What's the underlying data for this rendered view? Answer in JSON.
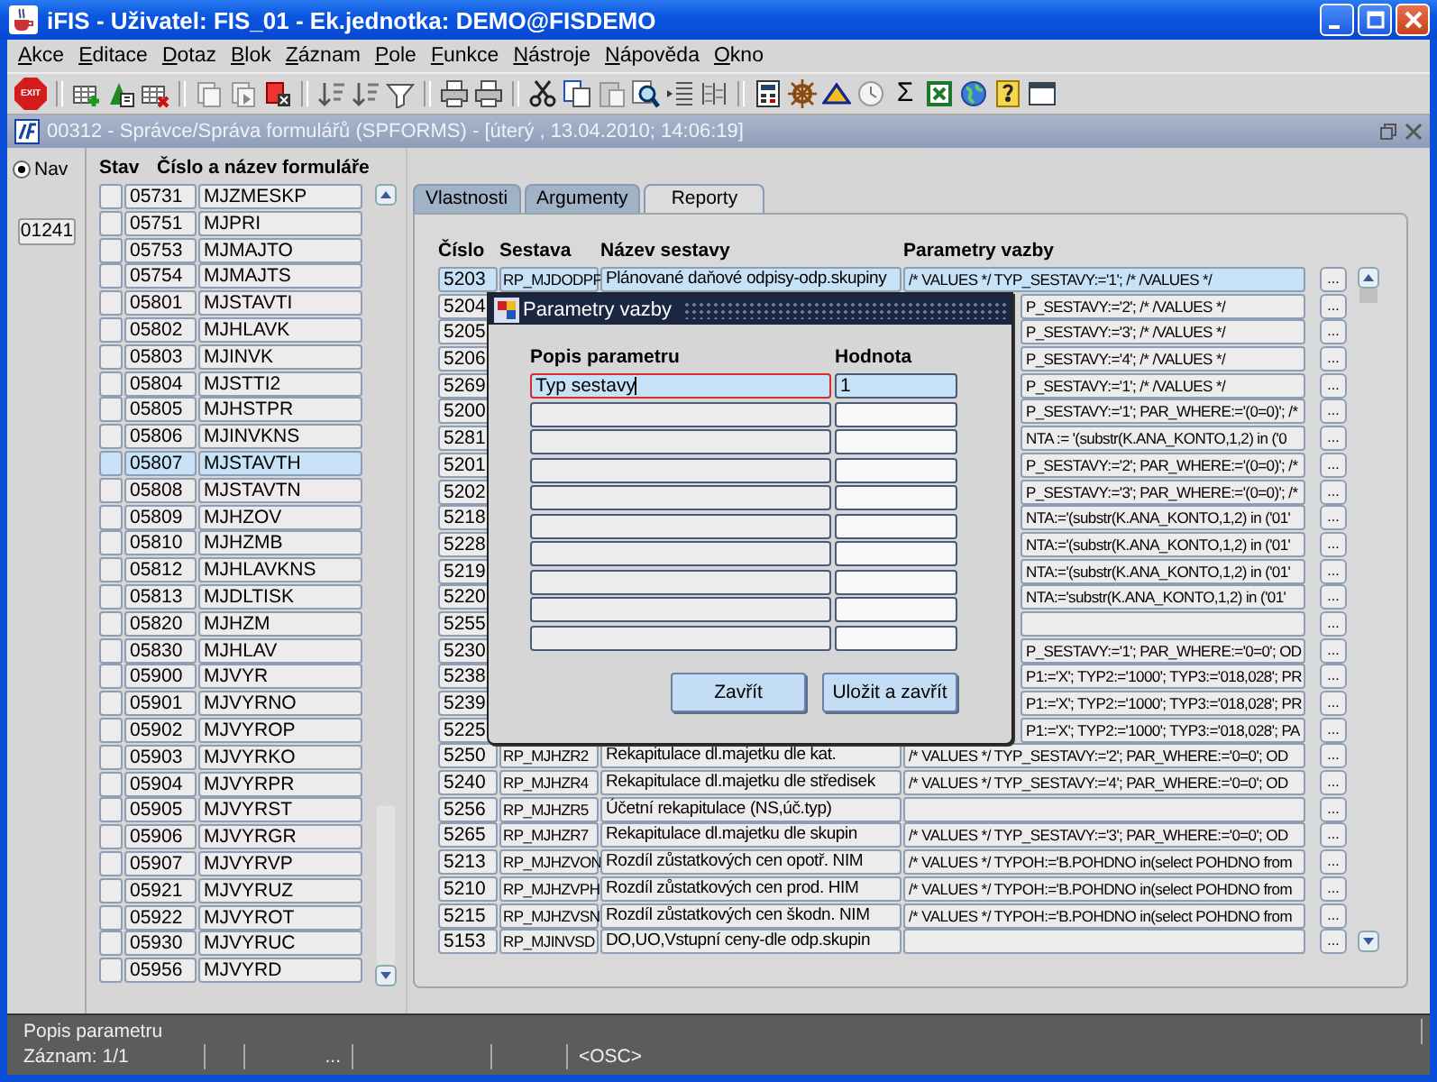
{
  "window": {
    "title": "iFIS - Uživatel: FIS_01 - Ek.jednotka: DEMO@FISDEMO"
  },
  "menu": [
    "Akce",
    "Editace",
    "Dotaz",
    "Blok",
    "Záznam",
    "Pole",
    "Funkce",
    "Nástroje",
    "Nápověda",
    "Okno"
  ],
  "toolbar": {
    "exit_label": "EXIT",
    "sum_label": "Σ"
  },
  "document": {
    "title": "00312 - Správce/Správa formulářů (SPFORMS) - [úterý , 13.04.2010; 14:06:19]",
    "active": false
  },
  "nav": {
    "label": "Nav",
    "selected": true,
    "count": "01241"
  },
  "forms": {
    "columns": [
      "Stav",
      "Číslo a název formuláře"
    ],
    "rows": [
      {
        "number": "05731",
        "name": "MJZMESKP",
        "selected": false
      },
      {
        "number": "05751",
        "name": "MJPRI",
        "selected": false
      },
      {
        "number": "05753",
        "name": "MJMAJTO",
        "selected": false
      },
      {
        "number": "05754",
        "name": "MJMAJTS",
        "selected": false
      },
      {
        "number": "05801",
        "name": "MJSTAVTI",
        "selected": false
      },
      {
        "number": "05802",
        "name": "MJHLAVK",
        "selected": false
      },
      {
        "number": "05803",
        "name": "MJINVK",
        "selected": false
      },
      {
        "number": "05804",
        "name": "MJSTTI2",
        "selected": false
      },
      {
        "number": "05805",
        "name": "MJHSTPR",
        "selected": false
      },
      {
        "number": "05806",
        "name": "MJINVKNS",
        "selected": false
      },
      {
        "number": "05807",
        "name": "MJSTAVTH",
        "selected": true
      },
      {
        "number": "05808",
        "name": "MJSTAVTN",
        "selected": false
      },
      {
        "number": "05809",
        "name": "MJHZOV",
        "selected": false
      },
      {
        "number": "05810",
        "name": "MJHZMB",
        "selected": false
      },
      {
        "number": "05812",
        "name": "MJHLAVKNS",
        "selected": false
      },
      {
        "number": "05813",
        "name": "MJDLTISK",
        "selected": false
      },
      {
        "number": "05820",
        "name": "MJHZM",
        "selected": false
      },
      {
        "number": "05830",
        "name": "MJHLAV",
        "selected": false
      },
      {
        "number": "05900",
        "name": "MJVYR",
        "selected": false
      },
      {
        "number": "05901",
        "name": "MJVYRNO",
        "selected": false
      },
      {
        "number": "05902",
        "name": "MJVYROP",
        "selected": false
      },
      {
        "number": "05903",
        "name": "MJVYRKO",
        "selected": false
      },
      {
        "number": "05904",
        "name": "MJVYRPR",
        "selected": false
      },
      {
        "number": "05905",
        "name": "MJVYRST",
        "selected": false
      },
      {
        "number": "05906",
        "name": "MJVYRGR",
        "selected": false
      },
      {
        "number": "05907",
        "name": "MJVYRVP",
        "selected": false
      },
      {
        "number": "05921",
        "name": "MJVYRUZ",
        "selected": false
      },
      {
        "number": "05922",
        "name": "MJVYROT",
        "selected": false
      },
      {
        "number": "05930",
        "name": "MJVYRUC",
        "selected": false
      },
      {
        "number": "05956",
        "name": "MJVYRD",
        "selected": false
      }
    ]
  },
  "tabs": [
    {
      "label": "Vlastnosti",
      "selected": false
    },
    {
      "label": "Argumenty",
      "selected": false
    },
    {
      "label": "Reporty",
      "selected": true
    }
  ],
  "reports": {
    "columns": [
      "Číslo",
      "Sestava",
      "Název sestavy",
      "Parametry vazby"
    ],
    "rows": [
      {
        "number": "5203",
        "report": "RP_MJDODPP",
        "title": "Plánované daňové odpisy-odp.skupiny",
        "params": "/* VALUES */ TYP_SESTAVY:='1'; /* /VALUES */",
        "button": "...",
        "selected": true
      },
      {
        "number": "5204",
        "params": "P_SESTAVY:='2'; /* /VALUES */",
        "button": "...",
        "selected": false
      },
      {
        "number": "5205",
        "params": "P_SESTAVY:='3'; /* /VALUES */",
        "button": "...",
        "selected": false
      },
      {
        "number": "5206",
        "params": "P_SESTAVY:='4'; /* /VALUES */",
        "button": "...",
        "selected": false
      },
      {
        "number": "5269",
        "params": "P_SESTAVY:='1'; /* /VALUES */",
        "button": "...",
        "selected": false
      },
      {
        "number": "5200",
        "params": "P_SESTAVY:='1'; PAR_WHERE:='(0=0)'; /*",
        "button": "...",
        "selected": false
      },
      {
        "number": "5281",
        "params": "NTA := '(substr(K.ANA_KONTO,1,2) in ('0",
        "button": "...",
        "selected": false
      },
      {
        "number": "5201",
        "params": "P_SESTAVY:='2'; PAR_WHERE:='(0=0)'; /*",
        "button": "...",
        "selected": false
      },
      {
        "number": "5202",
        "params": "P_SESTAVY:='3'; PAR_WHERE:='(0=0)'; /*",
        "button": "...",
        "selected": false
      },
      {
        "number": "5218",
        "params": "NTA:='(substr(K.ANA_KONTO,1,2) in ('01'",
        "button": "...",
        "selected": false
      },
      {
        "number": "5228",
        "params": "NTA:='(substr(K.ANA_KONTO,1,2) in ('01'",
        "button": "...",
        "selected": false
      },
      {
        "number": "5219",
        "params": "NTA:='(substr(K.ANA_KONTO,1,2) in ('01'",
        "button": "...",
        "selected": false
      },
      {
        "number": "5220",
        "params": "NTA:='substr(K.ANA_KONTO,1,2) in ('01'",
        "button": "...",
        "selected": false
      },
      {
        "number": "5255",
        "button": "...",
        "selected": false
      },
      {
        "number": "5230",
        "params": "P_SESTAVY:='1'; PAR_WHERE:='0=0'; OD",
        "button": "...",
        "selected": false
      },
      {
        "number": "5238",
        "params": "P1:='X'; TYP2:='1000'; TYP3:='018,028'; PR",
        "button": "...",
        "selected": false
      },
      {
        "number": "5239",
        "params": "P1:='X'; TYP2:='1000'; TYP3:='018,028'; PR",
        "button": "...",
        "selected": false
      },
      {
        "number": "5225",
        "params": "P1:='X'; TYP2:='1000'; TYP3:='018,028'; PA",
        "button": "...",
        "selected": false
      },
      {
        "number": "5250",
        "report": "RP_MJHZR2",
        "title": "Rekapitulace dl.majetku dle kat.",
        "params": "/* VALUES */ TYP_SESTAVY:='2'; PAR_WHERE:='0=0'; OD",
        "button": "...",
        "selected": false
      },
      {
        "number": "5240",
        "report": "RP_MJHZR4",
        "title": "Rekapitulace dl.majetku dle středisek",
        "params": "/* VALUES */ TYP_SESTAVY:='4'; PAR_WHERE:='0=0'; OD",
        "button": "...",
        "selected": false
      },
      {
        "number": "5256",
        "report": "RP_MJHZR5",
        "title": "Účetní rekapitulace (NS,úč.typ)",
        "button": "...",
        "selected": false
      },
      {
        "number": "5265",
        "report": "RP_MJHZR7",
        "title": "Rekapitulace dl.majetku dle skupin",
        "params": "/* VALUES */ TYP_SESTAVY:='3'; PAR_WHERE:='0=0'; OD",
        "button": "...",
        "selected": false
      },
      {
        "number": "5213",
        "report": "RP_MJHZVON",
        "title": "Rozdíl zůstatkových cen opotř. NIM",
        "params": "/* VALUES */ TYPOH:='B.POHDNO in(select POHDNO from",
        "button": "...",
        "selected": false
      },
      {
        "number": "5210",
        "report": "RP_MJHZVPH",
        "title": "Rozdíl zůstatkových cen prod. HIM",
        "params": "/* VALUES */ TYPOH:='B.POHDNO in(select POHDNO from",
        "button": "...",
        "selected": false
      },
      {
        "number": "5215",
        "report": "RP_MJHZVSN",
        "title": "Rozdíl zůstatkových cen škodn. NIM",
        "params": "/* VALUES */ TYPOH:='B.POHDNO in(select POHDNO from",
        "button": "...",
        "selected": false
      },
      {
        "number": "5153",
        "report": "RP_MJINVSD",
        "title": "DO,UO,Vstupní ceny-dle odp.skupin",
        "button": "...",
        "selected": false
      }
    ]
  },
  "dialog": {
    "title": "Parametry vazby",
    "columns": [
      "Popis parametru",
      "Hodnota"
    ],
    "rows": [
      {
        "description": "Typ sestavy",
        "value": "1",
        "selected": true
      },
      {
        "selected": false
      },
      {
        "selected": false
      },
      {
        "selected": false
      },
      {
        "selected": false
      },
      {
        "selected": false
      },
      {
        "selected": false
      },
      {
        "selected": false
      },
      {
        "selected": false
      },
      {
        "selected": false
      }
    ],
    "buttons": [
      "Zavřít",
      "Uložit a zavřít"
    ]
  },
  "status": {
    "hint": "Popis parametru",
    "record": "Záznam: 1/1",
    "ellipsis": "...",
    "mode": "<OSC>"
  }
}
